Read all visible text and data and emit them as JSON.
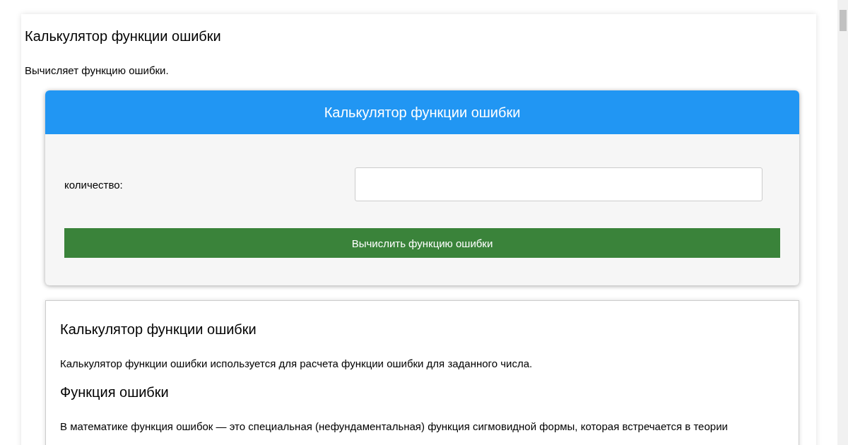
{
  "page": {
    "title": "Калькулятор функции ошибки",
    "subtitle": "Вычисляет функцию ошибки."
  },
  "calculator": {
    "header": "Калькулятор функции ошибки",
    "field": {
      "label": "количество:"
    },
    "button": "Вычислить функцию ошибки"
  },
  "article": {
    "title": "Калькулятор функции ошибки",
    "intro": "Калькулятор функции ошибки используется для расчета функции ошибки для заданного числа.",
    "section_title": "Функция ошибки",
    "paragraph": "В математике функция ошибок — это специальная (нефундаментальная) функция сигмовидной формы, которая встречается в теории"
  }
}
